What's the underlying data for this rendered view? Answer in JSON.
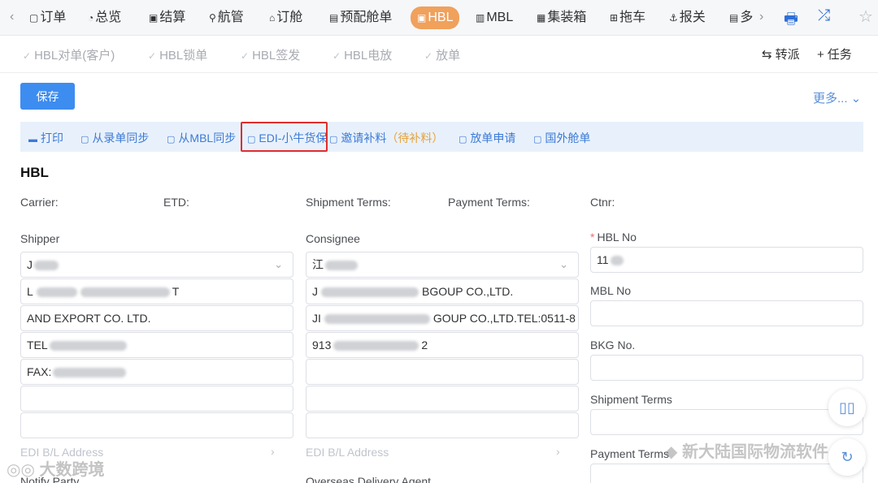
{
  "nav": {
    "prev": "‹",
    "next": "›",
    "items": [
      {
        "label": "订单",
        "icon": "▢"
      },
      {
        "label": "总览",
        "icon": "◔"
      },
      {
        "label": "结算",
        "icon": "▣"
      },
      {
        "label": "航管",
        "icon": "⚲"
      },
      {
        "label": "订舱",
        "icon": "⌂"
      },
      {
        "label": "预配舱单",
        "icon": "▤"
      },
      {
        "label": "HBL",
        "icon": "▣"
      },
      {
        "label": "MBL",
        "icon": "▥"
      },
      {
        "label": "集装箱",
        "icon": "▦"
      },
      {
        "label": "拖车",
        "icon": "⊞"
      },
      {
        "label": "报关",
        "icon": "⚓"
      },
      {
        "label": "多",
        "icon": "▤"
      }
    ],
    "print_icon": "🖶",
    "shuffle_icon": "⤮",
    "star_icon": "☆"
  },
  "status": {
    "items": [
      "HBL对单(客户)",
      "HBL锁单",
      "HBL签发",
      "HBL电放",
      "放单"
    ],
    "check": "✓",
    "transfer": "转派",
    "transfer_icon": "⇆",
    "task": "任务",
    "task_icon": "+"
  },
  "toolbar": {
    "save": "保存",
    "more": "更多... ⌄"
  },
  "actions": {
    "print": "打印",
    "sync_entry": "从录单同步",
    "sync_mbl": "从MBL同步",
    "edi": "EDI-小牛货保",
    "invite": "邀请补料",
    "pending_open": "（",
    "pending": "待补料",
    "pending_close": "）",
    "release": "放单申请",
    "foreign": "国外舱单"
  },
  "section": {
    "title": "HBL"
  },
  "summary": {
    "carrier": "Carrier:",
    "etd": "ETD:",
    "shipment_terms": "Shipment Terms:",
    "payment_terms": "Payment Terms:",
    "ctnr": "Ctnr:"
  },
  "shipper": {
    "label": "Shipper",
    "select": "J",
    "line1_a": "L",
    "line1_b": "T",
    "line2": "AND EXPORT CO. LTD.",
    "line3": "TEL",
    "line4": "FAX:",
    "edi_label": "EDI B/L Address"
  },
  "consignee": {
    "label": "Consignee",
    "select": "江",
    "line1_a": "J",
    "line1_b": "BGOUP CO.,LTD.",
    "line2_a": "JI",
    "line2_b": "GOUP CO.,LTD.TEL:0511-8",
    "line3_a": "913",
    "line3_b": "2",
    "edi_label": "EDI B/L Address"
  },
  "right": {
    "hbl_no_req": "*",
    "hbl_no_label": "HBL No",
    "hbl_no_value": "11",
    "mbl_no_label": "MBL No",
    "bkg_no_label": "BKG No.",
    "shipment_terms_label": "Shipment Terms",
    "payment_terms_label": "Payment Terms"
  },
  "bottom": {
    "notify": "Notify Party",
    "overseas": "Overseas Delivery Agent"
  },
  "floats": {
    "book_icon": "▯▯",
    "refresh_icon": "↻"
  },
  "watermarks": {
    "left": "大数跨境",
    "left_icon": "◎◎",
    "right": "新大陆国际物流软件"
  }
}
